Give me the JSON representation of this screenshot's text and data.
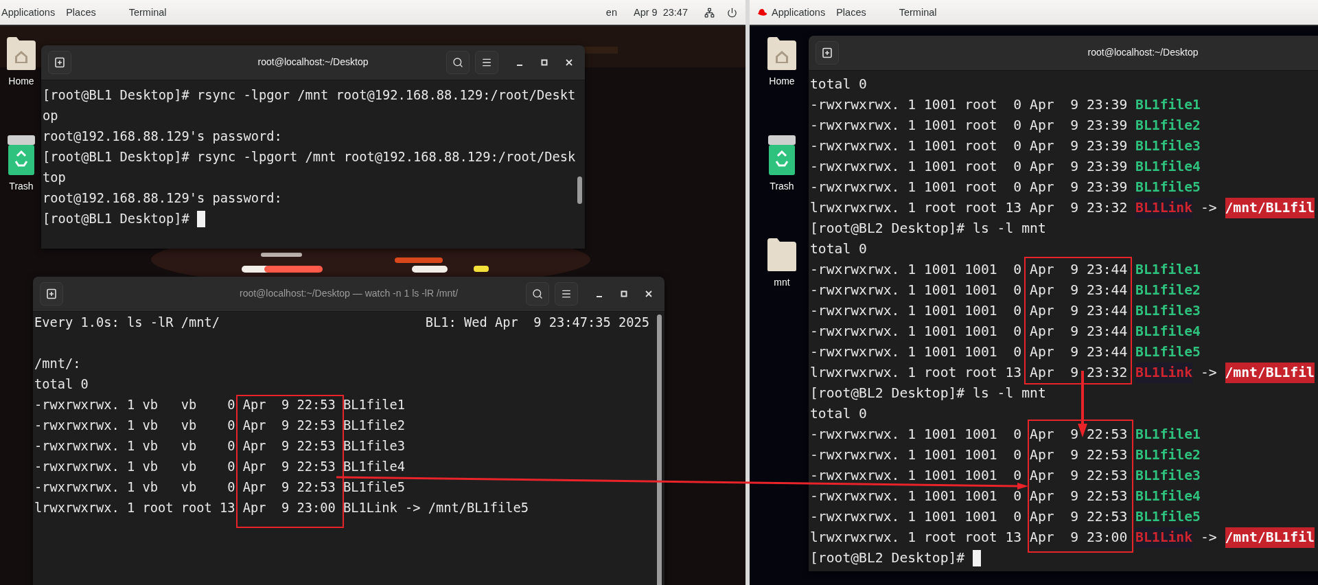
{
  "left_screen": {
    "top_bar": {
      "menus": [
        "Applications",
        "Places",
        "Terminal"
      ],
      "language": "en",
      "clock": "Apr 9  23:47"
    },
    "desktop_icons": [
      {
        "kind": "home",
        "label": "Home"
      },
      {
        "kind": "trash",
        "label": "Trash"
      }
    ],
    "windows": [
      {
        "title": "root@localhost:~/Desktop",
        "focused": true,
        "lines": [
          {
            "kind": "plain",
            "text": "[root@BL1 Desktop]# rsync -lpgor /mnt root@192.168.88.129:/root/Deskt"
          },
          {
            "kind": "plain",
            "text": "op"
          },
          {
            "kind": "plain",
            "text": "root@192.168.88.129's password:"
          },
          {
            "kind": "plain",
            "text": "[root@BL1 Desktop]# rsync -lpgort /mnt root@192.168.88.129:/root/Desk"
          },
          {
            "kind": "plain",
            "text": "top"
          },
          {
            "kind": "plain",
            "text": "root@192.168.88.129's password:"
          },
          {
            "kind": "plain",
            "text": "[root@BL1 Desktop]#",
            "cursor": true
          }
        ]
      },
      {
        "title": "root@localhost:~/Desktop — watch -n 1 ls -lR /mnt/",
        "focused": false,
        "lines": [
          {
            "kind": "header",
            "text": "Every 1.0s: ls -lR /mnt/",
            "right": "BL1: Wed Apr  9 23:47:35 2025"
          },
          {
            "kind": "plain",
            "text": "/mnt/:"
          },
          {
            "kind": "plain",
            "text": "total 0"
          },
          {
            "kind": "plain",
            "text": "-rwxrwxrwx. 1 vb   vb    0 Apr  9 22:53 BL1file1"
          },
          {
            "kind": "plain",
            "text": "-rwxrwxrwx. 1 vb   vb    0 Apr  9 22:53 BL1file2"
          },
          {
            "kind": "plain",
            "text": "-rwxrwxrwx. 1 vb   vb    0 Apr  9 22:53 BL1file3"
          },
          {
            "kind": "plain",
            "text": "-rwxrwxrwx. 1 vb   vb    0 Apr  9 22:53 BL1file4"
          },
          {
            "kind": "plain",
            "text": "-rwxrwxrwx. 1 vb   vb    0 Apr  9 22:53 BL1file5"
          },
          {
            "kind": "plain",
            "text": "lrwxrwxrwx. 1 root root 13 Apr  9 23:00 BL1Link -> /mnt/BL1file5"
          }
        ]
      }
    ]
  },
  "right_screen": {
    "top_bar": {
      "menus": [
        "Applications",
        "Places",
        "Terminal"
      ]
    },
    "desktop_icons": [
      {
        "kind": "home",
        "label": "Home"
      },
      {
        "kind": "trash",
        "label": "Trash"
      },
      {
        "kind": "folder",
        "label": "mnt"
      }
    ],
    "windows": [
      {
        "title": "root@localhost:~/Desktop",
        "focused": true,
        "lines": [
          {
            "kind": "plain",
            "text": "total 0"
          },
          {
            "kind": "file",
            "text": "-rwxrwxrwx. 1 1001 root  0 Apr  9 23:39",
            "name": "BL1file1"
          },
          {
            "kind": "file",
            "text": "-rwxrwxrwx. 1 1001 root  0 Apr  9 23:39",
            "name": "BL1file2"
          },
          {
            "kind": "file",
            "text": "-rwxrwxrwx. 1 1001 root  0 Apr  9 23:39",
            "name": "BL1file3"
          },
          {
            "kind": "file",
            "text": "-rwxrwxrwx. 1 1001 root  0 Apr  9 23:39",
            "name": "BL1file4"
          },
          {
            "kind": "file",
            "text": "-rwxrwxrwx. 1 1001 root  0 Apr  9 23:39",
            "name": "BL1file5"
          },
          {
            "kind": "link",
            "text": "lrwxrwxrwx. 1 root root 13 Apr  9 23:32",
            "name": "BL1Link",
            "arrow": "->",
            "target": "/mnt/BL1fil"
          },
          {
            "kind": "plain",
            "text": "[root@BL2 Desktop]# ls -l mnt"
          },
          {
            "kind": "plain",
            "text": "total 0"
          },
          {
            "kind": "file",
            "text": "-rwxrwxrwx. 1 1001 1001  0 Apr  9 23:44",
            "name": "BL1file1"
          },
          {
            "kind": "file",
            "text": "-rwxrwxrwx. 1 1001 1001  0 Apr  9 23:44",
            "name": "BL1file2"
          },
          {
            "kind": "file",
            "text": "-rwxrwxrwx. 1 1001 1001  0 Apr  9 23:44",
            "name": "BL1file3"
          },
          {
            "kind": "file",
            "text": "-rwxrwxrwx. 1 1001 1001  0 Apr  9 23:44",
            "name": "BL1file4"
          },
          {
            "kind": "file",
            "text": "-rwxrwxrwx. 1 1001 1001  0 Apr  9 23:44",
            "name": "BL1file5"
          },
          {
            "kind": "link",
            "text": "lrwxrwxrwx. 1 root root 13 Apr  9 23:32",
            "name": "BL1Link",
            "arrow": "->",
            "target": "/mnt/BL1fil"
          },
          {
            "kind": "plain",
            "text": "[root@BL2 Desktop]# ls -l mnt"
          },
          {
            "kind": "plain",
            "text": "total 0"
          },
          {
            "kind": "file",
            "text": "-rwxrwxrwx. 1 1001 1001  0 Apr  9 22:53",
            "name": "BL1file1"
          },
          {
            "kind": "file",
            "text": "-rwxrwxrwx. 1 1001 1001  0 Apr  9 22:53",
            "name": "BL1file2"
          },
          {
            "kind": "file",
            "text": "-rwxrwxrwx. 1 1001 1001  0 Apr  9 22:53",
            "name": "BL1file3"
          },
          {
            "kind": "file",
            "text": "-rwxrwxrwx. 1 1001 1001  0 Apr  9 22:53",
            "name": "BL1file4"
          },
          {
            "kind": "file",
            "text": "-rwxrwxrwx. 1 1001 1001  0 Apr  9 22:53",
            "name": "BL1file5"
          },
          {
            "kind": "link",
            "text": "lrwxrwxrwx. 1 root root 13 Apr  9 23:00",
            "name": "BL1Link",
            "arrow": "->",
            "target": "/mnt/BL1fil"
          },
          {
            "kind": "plain",
            "text": "[root@BL2 Desktop]#",
            "cursor": true
          }
        ]
      }
    ]
  }
}
